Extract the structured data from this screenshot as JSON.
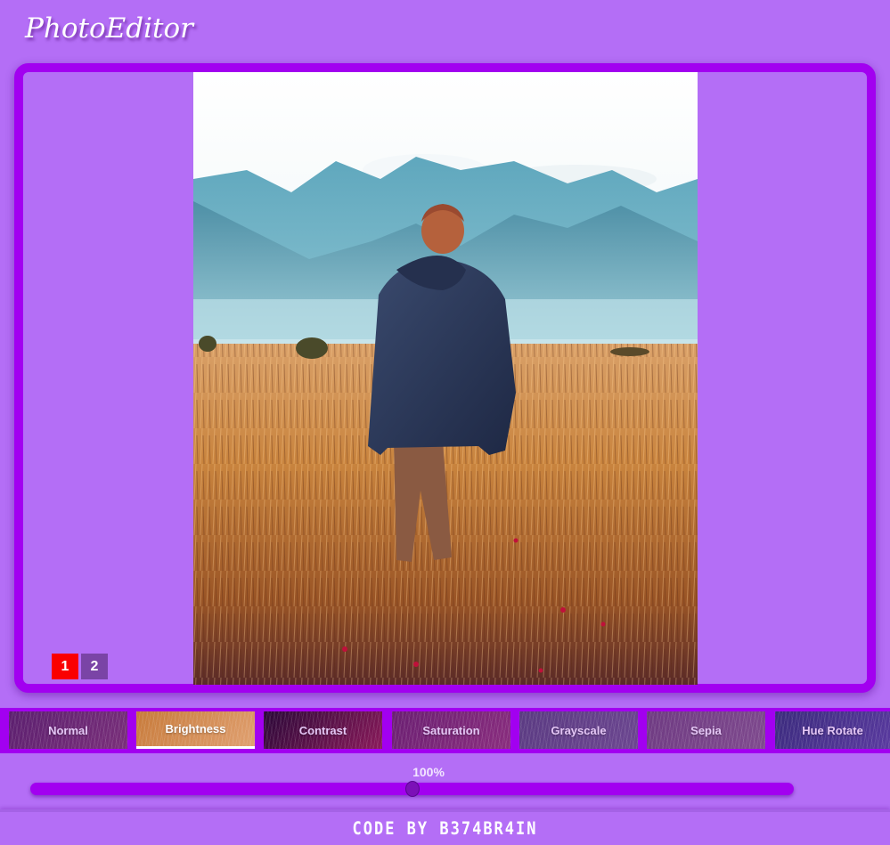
{
  "app": {
    "title": "PhotoEditor"
  },
  "pager": {
    "pages": [
      "1",
      "2"
    ],
    "active": "1"
  },
  "filters": [
    {
      "label": "Normal",
      "active": false,
      "colors": [
        "#5b1f6f",
        "#7a2f7a"
      ]
    },
    {
      "label": "Brightness",
      "active": true,
      "colors": [
        "#c77a3a",
        "#e0a070"
      ]
    },
    {
      "label": "Contrast",
      "active": false,
      "colors": [
        "#2a0838",
        "#8a1a5a"
      ]
    },
    {
      "label": "Saturation",
      "active": false,
      "colors": [
        "#6a1f72",
        "#8a2d7e"
      ]
    },
    {
      "label": "Grayscale",
      "active": false,
      "colors": [
        "#5a3a82",
        "#6c4690"
      ]
    },
    {
      "label": "Sepia",
      "active": false,
      "colors": [
        "#6e3a82",
        "#7f4a8e"
      ]
    },
    {
      "label": "Hue Rotate",
      "active": false,
      "colors": [
        "#3a2a7c",
        "#5a3aa0"
      ]
    }
  ],
  "slider": {
    "value_label": "100%",
    "value": 0.5
  },
  "footer": {
    "credit": "CODE BY B374BR4IN"
  },
  "colors": {
    "background": "#b46ef6",
    "accent": "#a200f0",
    "active_page": "#fa0000",
    "inactive_page": "#7a44a6"
  },
  "image": {
    "description_icon": "photo-man-in-field"
  }
}
